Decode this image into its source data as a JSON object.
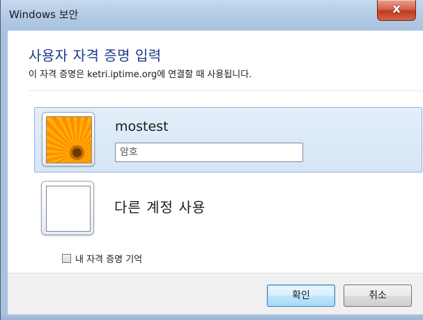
{
  "window": {
    "title": "Windows 보안",
    "close_label": "x"
  },
  "dialog": {
    "heading": "사용자 자격 증명 입력",
    "subheading": "이 자격 증명은 ketri.iptime.org에 연결할 때 사용됩니다."
  },
  "accounts": {
    "selected": {
      "username": "mostest",
      "password_placeholder": "암호",
      "password_value": ""
    },
    "other": {
      "label": "다른 계정 사용"
    }
  },
  "remember": {
    "label": "내 자격 증명 기억",
    "checked": false
  },
  "buttons": {
    "ok_label": "확인",
    "cancel_label": "취소"
  },
  "colors": {
    "heading": "#1e3a8a",
    "selected_tile": "#d6e6f6",
    "close_button": "#c13a1f"
  }
}
